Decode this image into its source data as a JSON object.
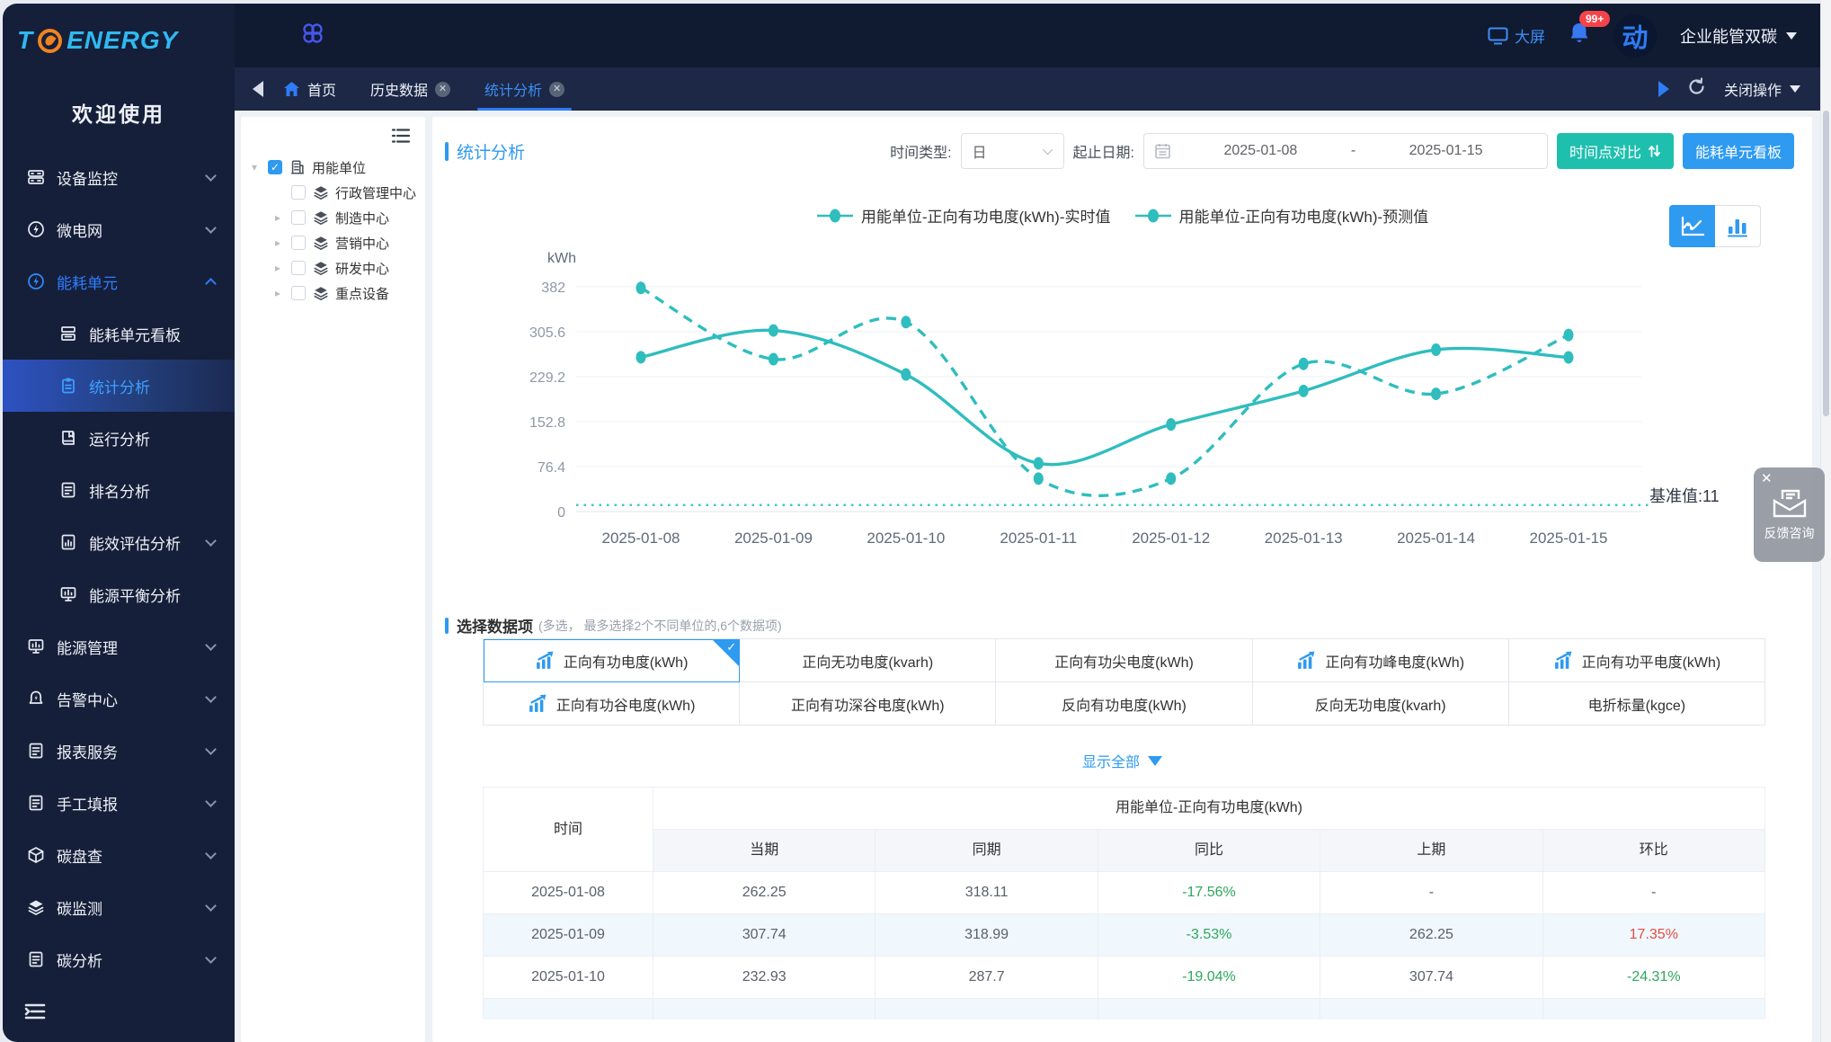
{
  "sidebar": {
    "logo": {
      "t": "T",
      "energy": "ENERGY"
    },
    "welcome": "欢迎使用",
    "items": [
      {
        "label": "设备监控",
        "icon": "device-monitor-icon",
        "chevron": "down",
        "level": 0
      },
      {
        "label": "微电网",
        "icon": "microgrid-icon",
        "chevron": "down",
        "level": 0
      },
      {
        "label": "能耗单元",
        "icon": "energy-unit-icon",
        "chevron": "up",
        "level": 0,
        "state": "parent-active"
      },
      {
        "label": "能耗单元看板",
        "icon": "board-icon",
        "level": 1
      },
      {
        "label": "统计分析",
        "icon": "clipboard-icon",
        "level": 1,
        "state": "active"
      },
      {
        "label": "运行分析",
        "icon": "book-icon",
        "level": 1
      },
      {
        "label": "排名分析",
        "icon": "doc-icon",
        "level": 1
      },
      {
        "label": "能效评估分析",
        "icon": "doc-chart-icon",
        "level": 1,
        "chevron": "down"
      },
      {
        "label": "能源平衡分析",
        "icon": "monitor-chart-icon",
        "level": 1
      },
      {
        "label": "能源管理",
        "icon": "monitor-chart-icon",
        "chevron": "down",
        "level": 0
      },
      {
        "label": "告警中心",
        "icon": "alarm-icon",
        "chevron": "down",
        "level": 0
      },
      {
        "label": "报表服务",
        "icon": "doc-icon",
        "chevron": "down",
        "level": 0
      },
      {
        "label": "手工填报",
        "icon": "doc-icon",
        "chevron": "down",
        "level": 0
      },
      {
        "label": "碳盘查",
        "icon": "cube-icon",
        "chevron": "down",
        "level": 0
      },
      {
        "label": "碳监测",
        "icon": "layers-icon",
        "chevron": "down",
        "level": 0
      },
      {
        "label": "碳分析",
        "icon": "doc-icon",
        "chevron": "down",
        "level": 0
      }
    ]
  },
  "topbar": {
    "big_screen": "大屏",
    "badge": "99+",
    "avatar_glyph": "动",
    "org": "企业能管双碳"
  },
  "tabbar": {
    "tabs": [
      {
        "label": "首页",
        "home": true,
        "closable": false,
        "active": false
      },
      {
        "label": "历史数据",
        "closable": true,
        "active": false
      },
      {
        "label": "统计分析",
        "closable": true,
        "active": true
      }
    ],
    "close_ops": "关闭操作"
  },
  "tree": {
    "nodes": [
      {
        "label": "用能单位",
        "icon": "building-icon",
        "caret": "down",
        "checked": true,
        "level": 0
      },
      {
        "label": "行政管理中心",
        "icon": "layers-icon",
        "caret": "none",
        "checked": false,
        "level": 1
      },
      {
        "label": "制造中心",
        "icon": "layers-icon",
        "caret": "right",
        "checked": false,
        "level": 1
      },
      {
        "label": "营销中心",
        "icon": "layers-icon",
        "caret": "right",
        "checked": false,
        "level": 1
      },
      {
        "label": "研发中心",
        "icon": "layers-icon",
        "caret": "right",
        "checked": false,
        "level": 1
      },
      {
        "label": "重点设备",
        "icon": "layers-icon",
        "caret": "right",
        "checked": false,
        "level": 1
      }
    ]
  },
  "toolbar": {
    "title": "统计分析",
    "time_type_label": "时间类型:",
    "time_type_value": "日",
    "date_range_label": "起止日期:",
    "date_start": "2025-01-08",
    "date_separator": "-",
    "date_end": "2025-01-15",
    "compare_button": "时间点对比",
    "board_button": "能耗单元看板"
  },
  "chart_data": {
    "type": "line",
    "ylabel": "kWh",
    "ylim": [
      0,
      382
    ],
    "yticks": [
      0,
      76.4,
      152.8,
      229.2,
      305.6,
      382
    ],
    "x": [
      "2025-01-08",
      "2025-01-09",
      "2025-01-10",
      "2025-01-11",
      "2025-01-12",
      "2025-01-13",
      "2025-01-14",
      "2025-01-15"
    ],
    "series": [
      {
        "name": "用能单位-正向有功电度(kWh)-实时值",
        "style": "solid",
        "values": [
          262.25,
          307.74,
          232.93,
          82,
          148,
          205,
          275,
          262
        ]
      },
      {
        "name": "用能单位-正向有功电度(kWh)-预测值",
        "style": "dashed",
        "values": [
          380,
          259,
          322,
          56,
          56,
          251,
          200,
          300
        ]
      }
    ],
    "baseline": {
      "label": "基准值:11",
      "value": 11
    },
    "color": "#2fbdbe",
    "grid": true,
    "legend_position": "top"
  },
  "data_items": {
    "title": "选择数据项",
    "note": "(多选， 最多选择2个不同单位的,6个数据项)",
    "show_all": "显示全部",
    "items": [
      {
        "label": "正向有功电度(kWh)",
        "icon": true,
        "selected": true
      },
      {
        "label": "正向无功电度(kvarh)",
        "icon": false,
        "selected": false
      },
      {
        "label": "正向有功尖电度(kWh)",
        "icon": false,
        "selected": false
      },
      {
        "label": "正向有功峰电度(kWh)",
        "icon": true,
        "selected": false
      },
      {
        "label": "正向有功平电度(kWh)",
        "icon": true,
        "selected": false
      },
      {
        "label": "正向有功谷电度(kWh)",
        "icon": true,
        "selected": false
      },
      {
        "label": "正向有功深谷电度(kWh)",
        "icon": false,
        "selected": false
      },
      {
        "label": "反向有功电度(kWh)",
        "icon": false,
        "selected": false
      },
      {
        "label": "反向无功电度(kvarh)",
        "icon": false,
        "selected": false
      },
      {
        "label": "电折标量(kgce)",
        "icon": false,
        "selected": false
      }
    ]
  },
  "table": {
    "time_header": "时间",
    "group_header": "用能单位-正向有功电度(kWh)",
    "columns": [
      "当期",
      "同期",
      "同比",
      "上期",
      "环比"
    ],
    "rows": [
      {
        "time": "2025-01-08",
        "cells": [
          {
            "v": "262.25"
          },
          {
            "v": "318.11"
          },
          {
            "v": "-17.56%",
            "c": "green"
          },
          {
            "v": "-"
          },
          {
            "v": "-"
          }
        ]
      },
      {
        "time": "2025-01-09",
        "cells": [
          {
            "v": "307.74"
          },
          {
            "v": "318.99"
          },
          {
            "v": "-3.53%",
            "c": "green"
          },
          {
            "v": "262.25"
          },
          {
            "v": "17.35%",
            "c": "red"
          }
        ]
      },
      {
        "time": "2025-01-10",
        "cells": [
          {
            "v": "232.93"
          },
          {
            "v": "287.7"
          },
          {
            "v": "-19.04%",
            "c": "green"
          },
          {
            "v": "307.74"
          },
          {
            "v": "-24.31%",
            "c": "green"
          }
        ]
      },
      {
        "time": "",
        "partial": true,
        "cells": [
          {
            "v": ""
          },
          {
            "v": ""
          },
          {
            "v": ""
          },
          {
            "v": ""
          },
          {
            "v": ""
          }
        ]
      }
    ]
  },
  "feedback": {
    "label": "反馈咨询",
    "close": "✕"
  }
}
